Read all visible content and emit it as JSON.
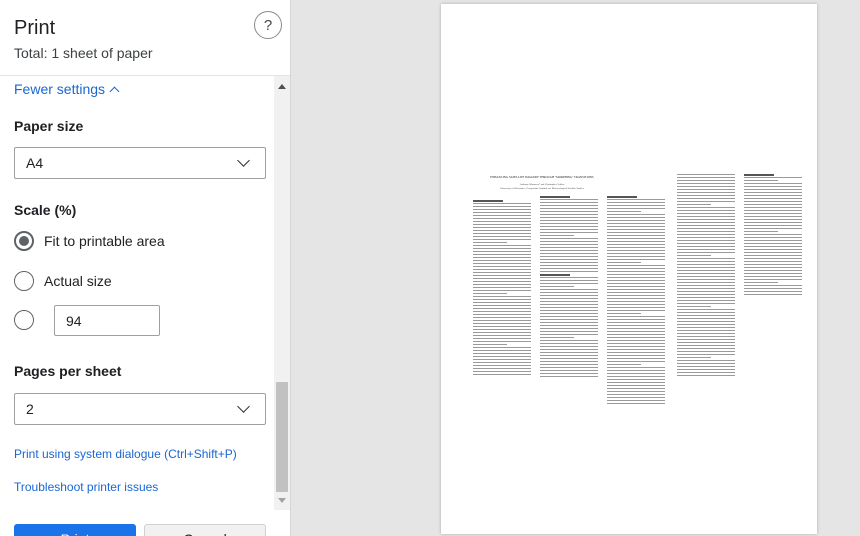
{
  "header": {
    "title": "Print",
    "subtitle": "Total: 1 sheet of paper",
    "help_symbol": "?"
  },
  "settings": {
    "fewer_label": "Fewer settings",
    "paper_size": {
      "label": "Paper size",
      "value": "A4"
    },
    "scale": {
      "label": "Scale (%)",
      "options": [
        {
          "label": "Fit to printable area",
          "selected": true
        },
        {
          "label": "Actual size",
          "selected": false
        },
        {
          "label": "",
          "selected": false
        }
      ],
      "custom_value": "94"
    },
    "pages_per_sheet": {
      "label": "Pages per sheet",
      "value": "2"
    },
    "system_dialog_link": "Print using system dialogue (Ctrl+Shift+P)",
    "troubleshoot_link": "Troubleshoot printer issues"
  },
  "buttons": {
    "print_label": "Print",
    "cancel_label": "Cancel"
  },
  "colors": {
    "accent": "#1967d2",
    "primary_button": "#1a73e8",
    "preview_background": "#e5e5e5"
  },
  "preview": {
    "paper_title": "ENHANCING SATELLITE IMAGERY THROUGH \"MORPHING\" TRANSITIONS",
    "paper_authors": "Anthony Wimmers* and Christopher Velden",
    "paper_affiliation": "University of Wisconsin - Cooperative Institute for Meteorological Satellite Studies"
  }
}
